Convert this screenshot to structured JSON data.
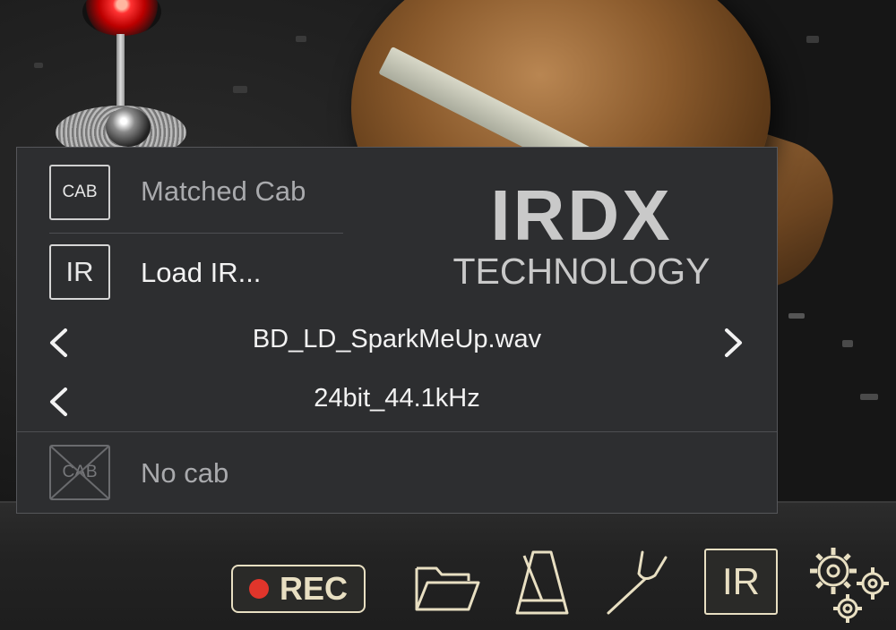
{
  "panel": {
    "matched_cab": {
      "badge": "CAB",
      "label": "Matched Cab"
    },
    "load_ir": {
      "badge": "IR",
      "label": "Load IR..."
    },
    "ir_file": {
      "name": "BD_LD_SparkMeUp.wav",
      "prev_icon": "chevron-left",
      "next_icon": "chevron-right"
    },
    "sample_format": {
      "value": "24bit_44.1kHz",
      "prev_icon": "chevron-left"
    },
    "no_cab": {
      "badge": "CAB",
      "label": "No cab"
    },
    "logo": {
      "line1": "IRDX",
      "line2": "TECHNOLOGY"
    }
  },
  "toolbar": {
    "rec_label": "REC",
    "ir_label": "IR",
    "icons": [
      "record-dot-icon",
      "folder-icon",
      "metronome-icon",
      "tuning-fork-icon",
      "ir-icon",
      "settings-gears-icon"
    ]
  },
  "colors": {
    "panel_bg": "#2d2e30",
    "text_active": "#f2f2f2",
    "text_dim": "#a9aaad",
    "toolbar_accent": "#e8dfc2",
    "rec_red": "#e0352b"
  }
}
